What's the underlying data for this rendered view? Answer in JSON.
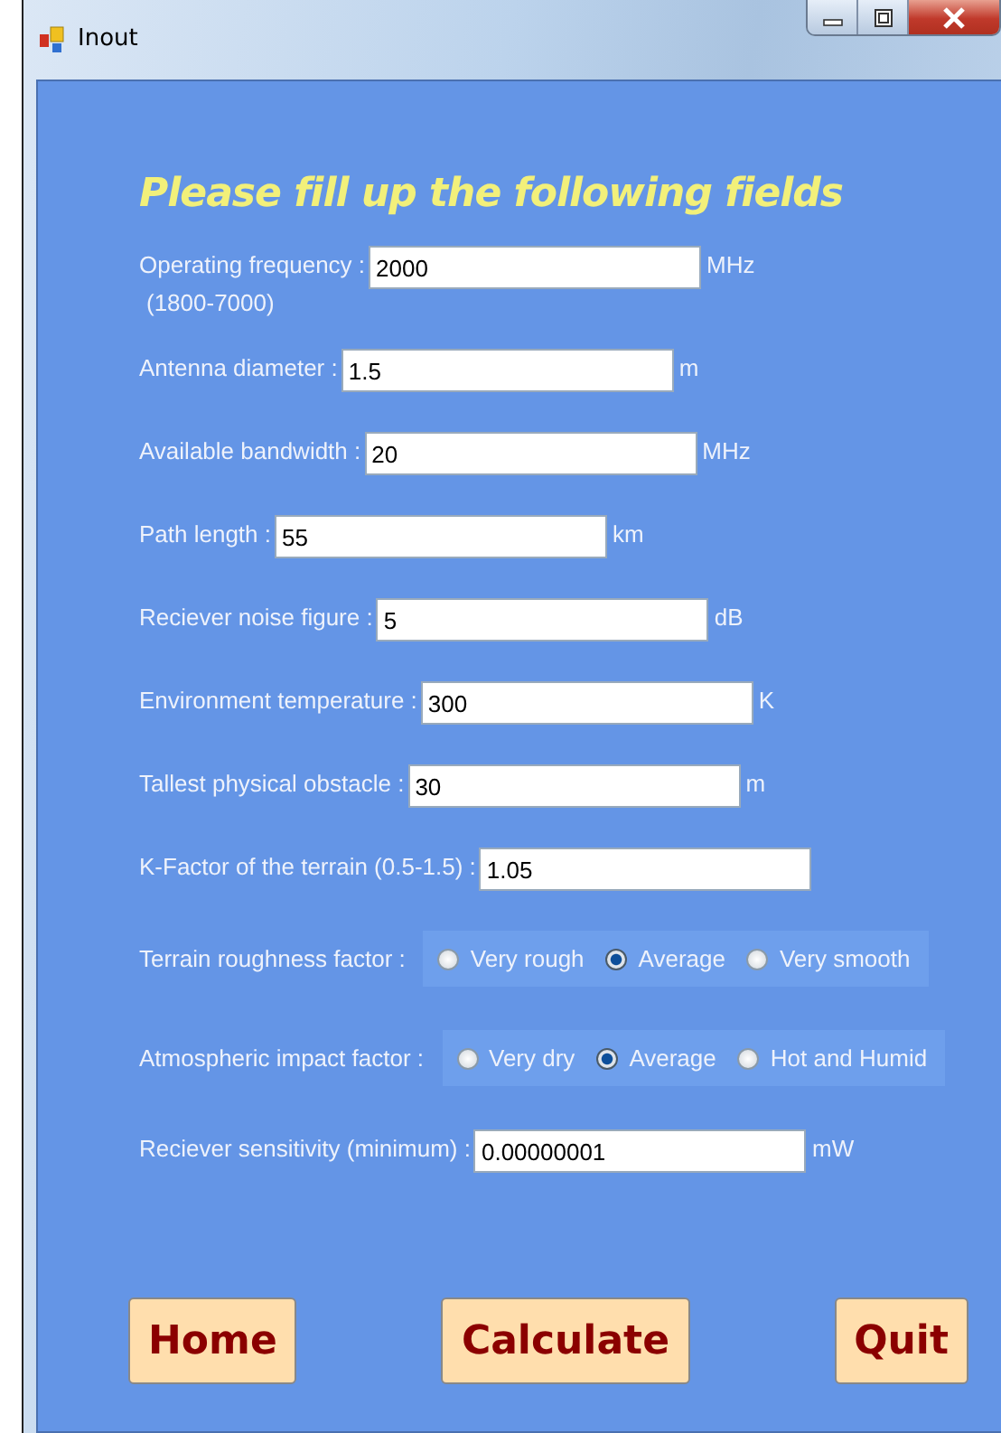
{
  "window": {
    "title": "Inout"
  },
  "heading": "Please fill up the following fields",
  "fields": [
    {
      "kind": "text",
      "label": "Operating frequency :",
      "note": "(1800-7000)",
      "value": "2000",
      "unit": "MHz"
    },
    {
      "kind": "text",
      "label": "Antenna diameter :",
      "value": "1.5",
      "unit": "m"
    },
    {
      "kind": "text",
      "label": "Available bandwidth :",
      "value": "20",
      "unit": "MHz"
    },
    {
      "kind": "text",
      "label": "Path length :",
      "value": "55",
      "unit": "km"
    },
    {
      "kind": "text",
      "label": "Reciever noise figure :",
      "value": "5",
      "unit": "dB"
    },
    {
      "kind": "text",
      "label": "Environment temperature :",
      "value": "300",
      "unit": "K"
    },
    {
      "kind": "text",
      "label": "Tallest physical obstacle :",
      "value": "30",
      "unit": "m"
    },
    {
      "kind": "text",
      "label": "K-Factor of the terrain (0.5-1.5) :",
      "value": "1.05"
    },
    {
      "kind": "radio",
      "label": "Terrain roughness factor :",
      "options": [
        {
          "label": "Very rough",
          "selected": false
        },
        {
          "label": "Average",
          "selected": true
        },
        {
          "label": "Very smooth",
          "selected": false
        }
      ]
    },
    {
      "kind": "radio",
      "label": "Atmospheric impact factor :",
      "options": [
        {
          "label": "Very dry",
          "selected": false
        },
        {
          "label": "Average",
          "selected": true
        },
        {
          "label": "Hot and Humid",
          "selected": false
        }
      ]
    },
    {
      "kind": "text",
      "label": "Reciever sensitivity (minimum) :",
      "value": "0.00000001",
      "unit": "mW"
    }
  ],
  "buttons": [
    "Home",
    "Calculate",
    "Quit"
  ]
}
